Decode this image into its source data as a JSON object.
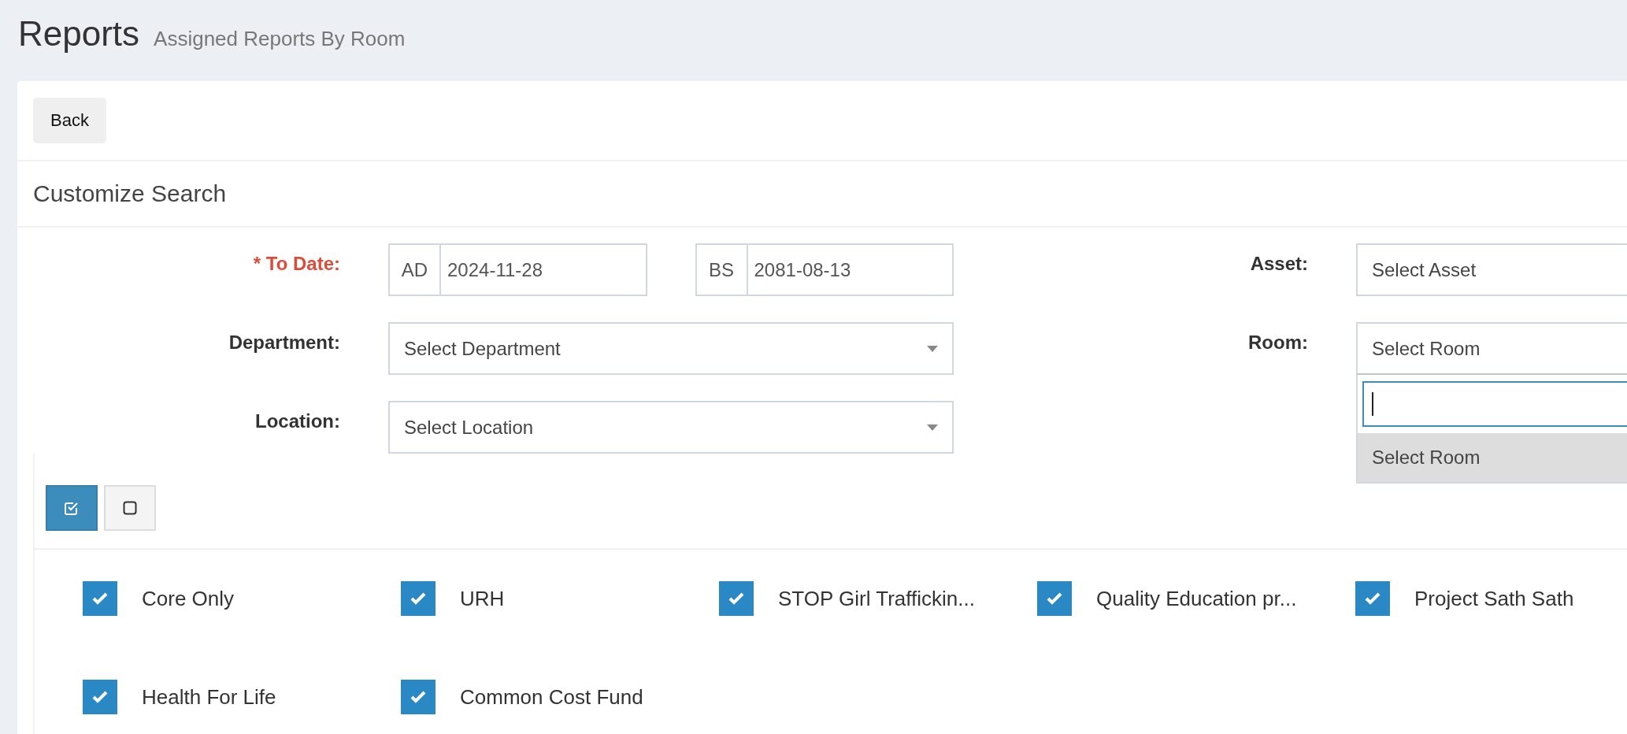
{
  "header": {
    "title": "Reports",
    "subtitle": "Assigned Reports By Room"
  },
  "back_button": {
    "label": "Back"
  },
  "panel_title": "Customize Search",
  "rows": [
    {
      "label": "* To Date:",
      "required": true,
      "control": {
        "kind": "date_pair",
        "dates": [
          {
            "calendar": "AD",
            "value": "2024-11-28"
          },
          {
            "calendar": "BS",
            "value": "2081-08-13"
          }
        ]
      },
      "side": {
        "label": "Asset:",
        "required": false,
        "control": {
          "kind": "select",
          "placeholder": "Select Asset",
          "expanded": false
        }
      }
    },
    {
      "label": "Department:",
      "required": false,
      "control": {
        "kind": "select",
        "placeholder": "Select Department",
        "expanded": false
      },
      "side": {
        "label": "Room:",
        "required": false,
        "control": {
          "kind": "select",
          "placeholder": "Select Room",
          "expanded": true,
          "options": [
            {
              "label": "Select Room",
              "highlighted": true
            }
          ]
        }
      }
    },
    {
      "label": "Location:",
      "required": false,
      "control": {
        "kind": "select",
        "placeholder": "Select Location",
        "expanded": false
      }
    }
  ],
  "bulk_buttons": [
    {
      "kind": "check_all",
      "selected": true
    },
    {
      "kind": "uncheck_all",
      "selected": false
    }
  ],
  "options": [
    {
      "label": "Core Only",
      "checked": true
    },
    {
      "label": "URH",
      "checked": true
    },
    {
      "label": "STOP Girl Traffickin...",
      "checked": true
    },
    {
      "label": "Quality Education pr...",
      "checked": true
    },
    {
      "label": "Project Sath Sath",
      "checked": true
    },
    {
      "label": "Health For Life",
      "checked": true
    },
    {
      "label": "Common Cost Fund",
      "checked": true
    }
  ]
}
